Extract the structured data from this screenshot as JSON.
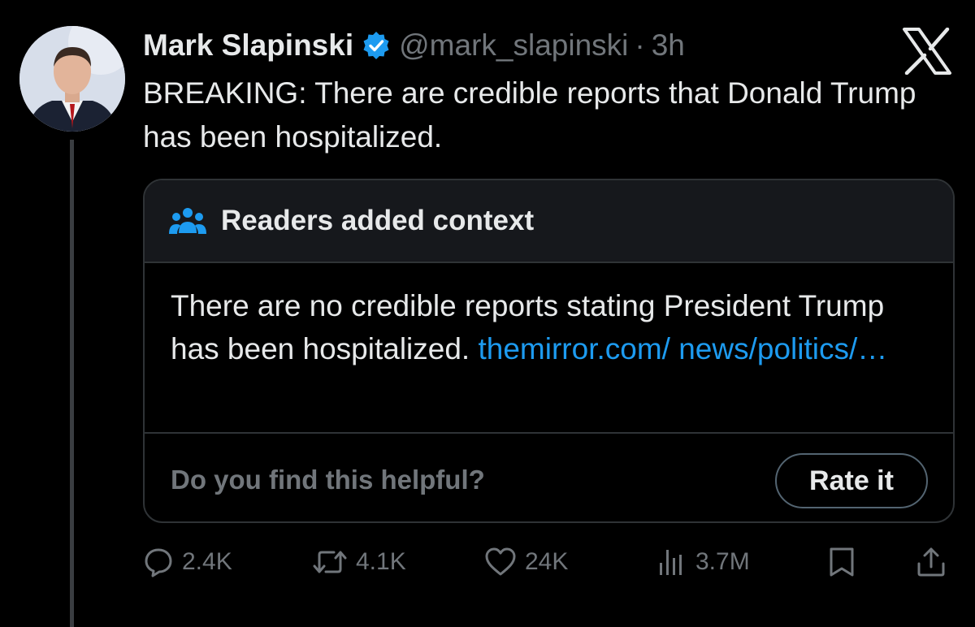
{
  "author": {
    "name": "Mark Slapinski",
    "handle": "@mark_slapinski",
    "separator": "·",
    "time": "3h"
  },
  "tweet": {
    "text": "BREAKING: There are credible reports that Donald Trump has been hospitalized."
  },
  "community_note": {
    "title": "Readers added context",
    "body": "There are no credible reports stating President Trump has been hospitalized. ",
    "link_text": "themirror.com/ news/politics/…",
    "helpful_prompt": "Do you find this helpful?",
    "rate_label": "Rate it"
  },
  "actions": {
    "replies": "2.4K",
    "reposts": "4.1K",
    "likes": "24K",
    "views": "3.7M"
  },
  "icons": {
    "verified": "verified-badge-icon",
    "platform": "x-logo-icon",
    "note": "people-icon",
    "reply": "reply-icon",
    "repost": "repost-icon",
    "like": "heart-icon",
    "views": "views-icon",
    "bookmark": "bookmark-icon",
    "share": "share-icon"
  },
  "colors": {
    "background": "#000000",
    "text": "#e7e9ea",
    "secondary": "#71767b",
    "accent": "#1d9bf0",
    "border": "#2f3336"
  }
}
